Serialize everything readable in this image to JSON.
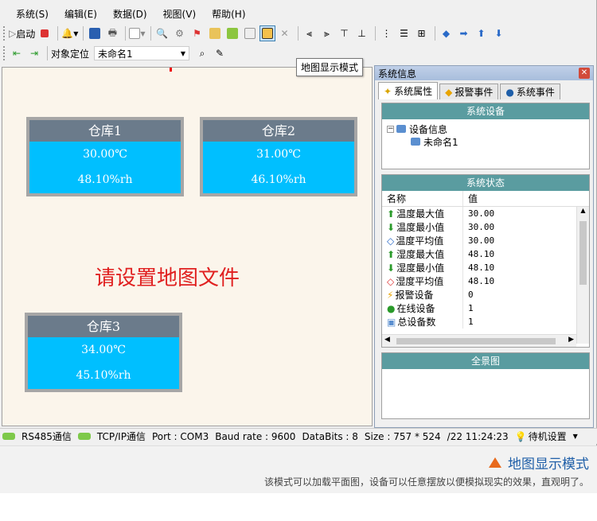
{
  "menu": [
    "系统(S)",
    "编辑(E)",
    "数据(D)",
    "视图(V)",
    "帮助(H)"
  ],
  "toolbar": {
    "start_label": "启动",
    "locate_label": "对象定位",
    "locate_value": "未命名1"
  },
  "tooltip": "地图显示模式",
  "map": {
    "warehouses": [
      {
        "name": "仓库1",
        "temp": "30.00℃",
        "hum": "48.10%rh"
      },
      {
        "name": "仓库2",
        "temp": "31.00℃",
        "hum": "46.10%rh"
      },
      {
        "name": "仓库3",
        "temp": "34.00℃",
        "hum": "45.10%rh"
      }
    ],
    "hint": "请设置地图文件"
  },
  "panel": {
    "title": "系统信息",
    "tabs": [
      "系统属性",
      "报警事件",
      "系统事件"
    ],
    "devices_header": "系统设备",
    "tree_root": "设备信息",
    "tree_child": "未命名1",
    "status_header": "系统状态",
    "grid_head": {
      "name": "名称",
      "value": "值"
    },
    "rows": [
      {
        "name": "温度最大值",
        "value": "30.00"
      },
      {
        "name": "温度最小值",
        "value": "30.00"
      },
      {
        "name": "温度平均值",
        "value": "30.00"
      },
      {
        "name": "湿度最大值",
        "value": "48.10"
      },
      {
        "name": "湿度最小值",
        "value": "48.10"
      },
      {
        "name": "湿度平均值",
        "value": "48.10"
      },
      {
        "name": "报警设备",
        "value": "0"
      },
      {
        "name": "在线设备",
        "value": "1"
      },
      {
        "name": "总设备数",
        "value": "1"
      }
    ],
    "overview_header": "全景图"
  },
  "status": {
    "rs485": "RS485通信",
    "tcp": "TCP/IP通信",
    "port": "Port : COM3",
    "baud": "Baud rate : 9600",
    "databits": "DataBits : 8",
    "size": "Size : 757 * 524",
    "time": "/22 11:24:23",
    "standby": "待机设置"
  },
  "caption": {
    "title": "地图显示模式",
    "desc": "该模式可以加载平面图，设备可以任意摆放以便模拟现实的效果，直观明了。"
  },
  "colors": {
    "accent": "#00bfff",
    "header": "#6b7b8b",
    "section": "#5a9ca0",
    "hint": "#e02020"
  }
}
